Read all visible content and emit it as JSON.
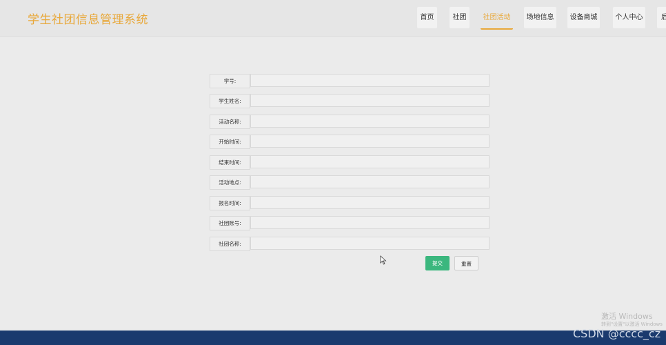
{
  "header": {
    "logo": "学生社团信息管理系统",
    "nav": [
      {
        "label": "首页"
      },
      {
        "label": "社团"
      },
      {
        "label": "社团活动"
      },
      {
        "label": "场地信息"
      },
      {
        "label": "设备商城"
      },
      {
        "label": "个人中心"
      },
      {
        "label": "后"
      }
    ],
    "active_index": 2
  },
  "form": {
    "fields": [
      {
        "label": "学号:",
        "value": ""
      },
      {
        "label": "学生姓名:",
        "value": ""
      },
      {
        "label": "活动名称:",
        "value": ""
      },
      {
        "label": "开始时间:",
        "value": ""
      },
      {
        "label": "结束时间:",
        "value": ""
      },
      {
        "label": "活动地点:",
        "value": ""
      },
      {
        "label": "报名时间:",
        "value": ""
      },
      {
        "label": "社团账号:",
        "value": ""
      },
      {
        "label": "社团名称:",
        "value": ""
      }
    ],
    "submit_label": "提交",
    "reset_label": "重置"
  },
  "watermark": {
    "title": "激活 Windows",
    "subtitle": "转到\"设置\"以激活 Windows"
  },
  "overlay": {
    "csdn": "CSDN @cccc_cz"
  },
  "colors": {
    "brand": "#e8a83a",
    "submit": "#3bb77e",
    "footer": "#1a3a6e"
  }
}
